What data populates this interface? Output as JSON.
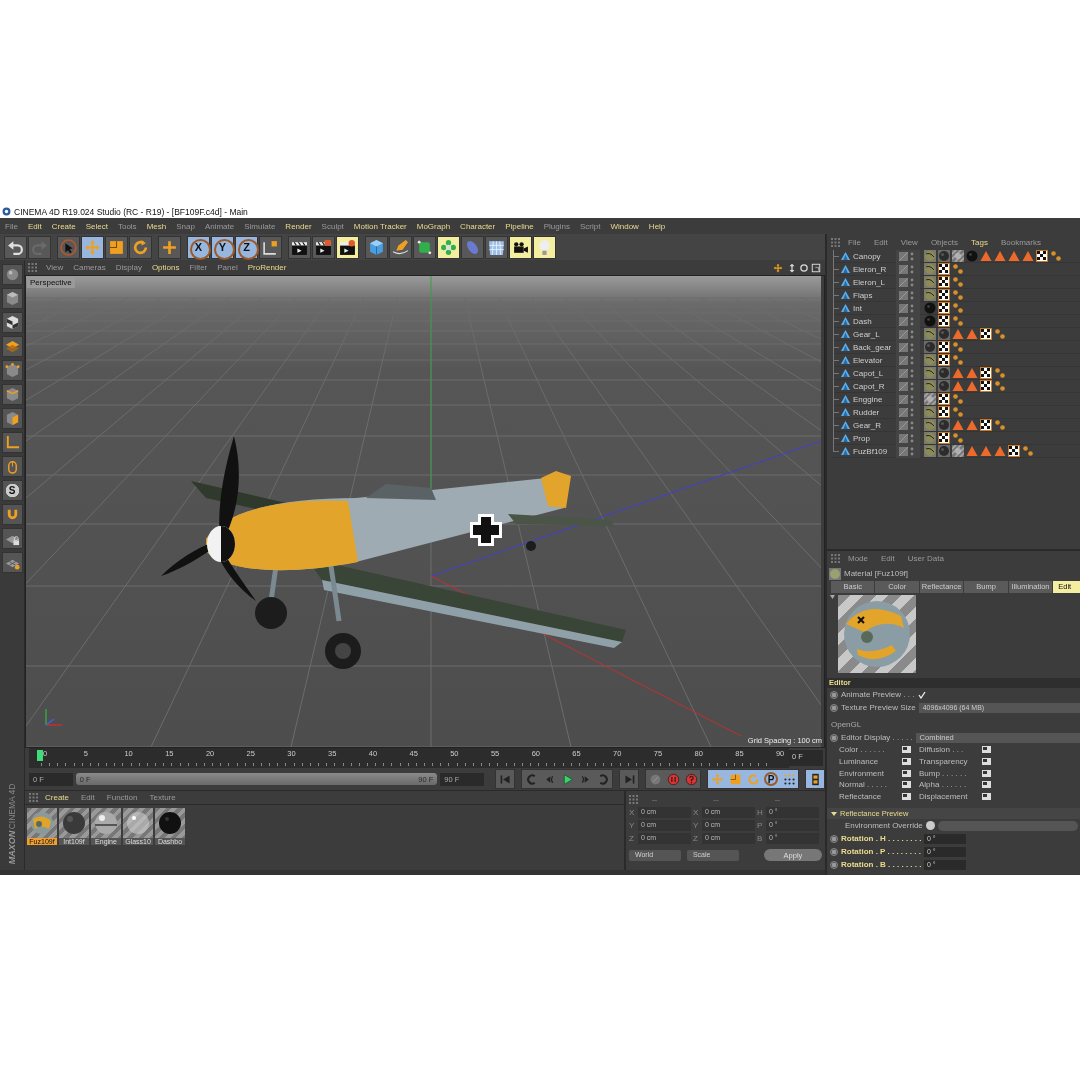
{
  "window": {
    "title": "CINEMA 4D R19.024 Studio (RC - R19) - [BF109F.c4d] - Main"
  },
  "menu": [
    {
      "label": "File",
      "highlighted": false
    },
    {
      "label": "Edit",
      "highlighted": true
    },
    {
      "label": "Create",
      "highlighted": true
    },
    {
      "label": "Select",
      "highlighted": true
    },
    {
      "label": "Tools",
      "highlighted": false
    },
    {
      "label": "Mesh",
      "highlighted": true
    },
    {
      "label": "Snap",
      "highlighted": false
    },
    {
      "label": "Animate",
      "highlighted": false
    },
    {
      "label": "Simulate",
      "highlighted": false
    },
    {
      "label": "Render",
      "highlighted": true
    },
    {
      "label": "Sculpt",
      "highlighted": false
    },
    {
      "label": "Motion Tracker",
      "highlighted": true
    },
    {
      "label": "MoGraph",
      "highlighted": true
    },
    {
      "label": "Character",
      "highlighted": true
    },
    {
      "label": "Pipeline",
      "highlighted": true
    },
    {
      "label": "Plugins",
      "highlighted": false
    },
    {
      "label": "Script",
      "highlighted": false
    },
    {
      "label": "Window",
      "highlighted": true
    },
    {
      "label": "Help",
      "highlighted": true
    }
  ],
  "toolbar": [
    {
      "tools": [
        {
          "kind": "undo",
          "selected": false
        },
        {
          "kind": "redo",
          "selected": false
        }
      ]
    },
    {
      "tools": [
        {
          "kind": "select",
          "selected": false
        },
        {
          "kind": "move",
          "selected": true
        },
        {
          "kind": "scale",
          "selected": false
        },
        {
          "kind": "rotate",
          "selected": false
        }
      ]
    },
    {
      "tools": [
        {
          "kind": "add",
          "selected": false
        }
      ]
    },
    {
      "tools": [
        {
          "kind": "axis",
          "label": "X",
          "selected": true
        },
        {
          "kind": "axis",
          "label": "Y",
          "selected": true
        },
        {
          "kind": "axis",
          "label": "Z",
          "selected": true
        },
        {
          "kind": "coordinates",
          "selected": false
        }
      ]
    },
    {
      "tools": [
        {
          "kind": "render-view",
          "selected": false
        },
        {
          "kind": "render-picture",
          "selected": false
        },
        {
          "kind": "render-settings",
          "selected": false
        }
      ]
    },
    {
      "tools": [
        {
          "kind": "cube",
          "selected": false
        },
        {
          "kind": "pen",
          "selected": false
        },
        {
          "kind": "subdivision",
          "selected": false
        },
        {
          "kind": "cloner",
          "selected": false
        },
        {
          "kind": "deformer",
          "selected": false
        },
        {
          "kind": "floor",
          "selected": false
        },
        {
          "kind": "camera",
          "selected": false
        },
        {
          "kind": "light",
          "selected": false
        }
      ]
    }
  ],
  "sidebar": {
    "tools": [
      {
        "kind": "sphere"
      },
      {
        "kind": "model"
      },
      {
        "kind": "texture"
      },
      {
        "kind": "workplane"
      },
      {
        "kind": "points"
      },
      {
        "kind": "edges"
      },
      {
        "kind": "polygons"
      },
      {
        "kind": "axis"
      },
      {
        "kind": "tweak"
      },
      {
        "kind": "snap",
        "label": "S"
      },
      {
        "kind": "magnet"
      },
      {
        "kind": "lock"
      },
      {
        "kind": "grid"
      }
    ],
    "logo": {
      "brand": "MAXON",
      "product": "CINEMA 4D"
    }
  },
  "viewport": {
    "menu": [
      {
        "label": "View",
        "highlighted": false
      },
      {
        "label": "Cameras",
        "highlighted": false
      },
      {
        "label": "Display",
        "highlighted": false
      },
      {
        "label": "Options",
        "highlighted": true
      },
      {
        "label": "Filter",
        "highlighted": false
      },
      {
        "label": "Panel",
        "highlighted": false
      },
      {
        "label": "ProRender",
        "highlighted": true
      }
    ],
    "camera": "Perspective",
    "grid_spacing": "Grid Spacing : 100 cm"
  },
  "timeline": {
    "ruler": [
      "0",
      "5",
      "10",
      "15",
      "20",
      "25",
      "30",
      "35",
      "40",
      "45",
      "50",
      "55",
      "60",
      "65",
      "70",
      "75",
      "80",
      "85",
      "90"
    ],
    "playhead": {
      "level": 0
    },
    "current_frame": "0 F",
    "start": "0 F",
    "range_start": "0 F",
    "range_bar": {
      "level": 1
    },
    "range_end": "90 F",
    "end": "90 F",
    "controls": [
      {
        "kind": "first"
      },
      {
        "kind": "prev-key"
      },
      {
        "kind": "prev-frame"
      },
      {
        "kind": "play"
      },
      {
        "kind": "next-frame"
      },
      {
        "kind": "next-key"
      },
      {
        "kind": "last"
      },
      {
        "kind": "key-off"
      },
      {
        "kind": "record"
      },
      {
        "kind": "autokey"
      },
      {
        "kind": "key-move"
      },
      {
        "kind": "key-scale"
      },
      {
        "kind": "key-rotate"
      },
      {
        "kind": "key-param",
        "label": "P"
      },
      {
        "kind": "key-points"
      },
      {
        "kind": "film"
      }
    ]
  },
  "materials": {
    "menu": [
      {
        "label": "Create",
        "highlighted": true
      },
      {
        "label": "Edit",
        "highlighted": false
      },
      {
        "label": "Function",
        "highlighted": false
      },
      {
        "label": "Texture",
        "highlighted": false
      }
    ],
    "items": [
      {
        "name": "Fuz109f",
        "kind": "camo",
        "selected": true
      },
      {
        "name": "Int109f",
        "kind": "dark",
        "selected": false
      },
      {
        "name": "Engine",
        "kind": "chrome",
        "selected": false
      },
      {
        "name": "Glass10",
        "kind": "glass",
        "selected": false
      },
      {
        "name": "Dashbo",
        "kind": "black",
        "selected": false
      }
    ]
  },
  "coordinates": {
    "headers": [
      "--",
      "--",
      "--"
    ],
    "rows": [
      [
        {
          "axis": "X",
          "value": "0 cm"
        },
        {
          "axis": "X",
          "value": "0 cm"
        },
        {
          "axis": "H",
          "value": "0 °"
        }
      ],
      [
        {
          "axis": "Y",
          "value": "0 cm"
        },
        {
          "axis": "Y",
          "value": "0 cm"
        },
        {
          "axis": "P",
          "value": "0 °"
        }
      ],
      [
        {
          "axis": "Z",
          "value": "0 cm"
        },
        {
          "axis": "Z",
          "value": "0 cm"
        },
        {
          "axis": "B",
          "value": "0 °"
        }
      ]
    ],
    "dropdowns": [
      "World",
      "Scale"
    ],
    "apply": "Apply"
  },
  "objects": {
    "menu": [
      {
        "label": "File",
        "highlighted": false
      },
      {
        "label": "Edit",
        "highlighted": false
      },
      {
        "label": "View",
        "highlighted": false
      },
      {
        "label": "Objects",
        "highlighted": false
      },
      {
        "label": "Tags",
        "highlighted": true
      },
      {
        "label": "Bookmarks",
        "highlighted": false
      }
    ],
    "items": [
      {
        "name": "Canopy",
        "tags": [
          {
            "kind": "texture"
          },
          {
            "kind": "sphere"
          },
          {
            "kind": "glass"
          },
          {
            "kind": "black"
          },
          {
            "kind": "selection"
          },
          {
            "kind": "selection"
          },
          {
            "kind": "selection"
          },
          {
            "kind": "selection"
          },
          {
            "kind": "uvw"
          },
          {
            "kind": "phong"
          }
        ]
      },
      {
        "name": "Eleron_R",
        "tags": [
          {
            "kind": "texture"
          },
          {
            "kind": "uvw"
          },
          {
            "kind": "phong"
          }
        ]
      },
      {
        "name": "Eleron_L",
        "tags": [
          {
            "kind": "texture"
          },
          {
            "kind": "uvw"
          },
          {
            "kind": "phong"
          }
        ]
      },
      {
        "name": "Flaps",
        "tags": [
          {
            "kind": "texture"
          },
          {
            "kind": "uvw"
          },
          {
            "kind": "phong"
          }
        ]
      },
      {
        "name": "Int",
        "tags": [
          {
            "kind": "black"
          },
          {
            "kind": "uvw"
          },
          {
            "kind": "phong"
          }
        ]
      },
      {
        "name": "Dash",
        "tags": [
          {
            "kind": "black"
          },
          {
            "kind": "uvw"
          },
          {
            "kind": "phong"
          }
        ]
      },
      {
        "name": "Gear_L",
        "tags": [
          {
            "kind": "texture"
          },
          {
            "kind": "sphere"
          },
          {
            "kind": "selection"
          },
          {
            "kind": "selection"
          },
          {
            "kind": "uvw"
          },
          {
            "kind": "phong"
          }
        ]
      },
      {
        "name": "Back_gear",
        "tags": [
          {
            "kind": "sphere"
          },
          {
            "kind": "uvw"
          },
          {
            "kind": "phong"
          }
        ]
      },
      {
        "name": "Elevator",
        "tags": [
          {
            "kind": "texture"
          },
          {
            "kind": "uvw"
          },
          {
            "kind": "phong"
          }
        ]
      },
      {
        "name": "Capot_L",
        "tags": [
          {
            "kind": "texture"
          },
          {
            "kind": "sphere"
          },
          {
            "kind": "selection"
          },
          {
            "kind": "selection"
          },
          {
            "kind": "uvw"
          },
          {
            "kind": "phong"
          }
        ]
      },
      {
        "name": "Capot_R",
        "tags": [
          {
            "kind": "texture"
          },
          {
            "kind": "sphere"
          },
          {
            "kind": "selection"
          },
          {
            "kind": "selection"
          },
          {
            "kind": "uvw"
          },
          {
            "kind": "phong"
          }
        ]
      },
      {
        "name": "Enggine",
        "tags": [
          {
            "kind": "glass"
          },
          {
            "kind": "uvw"
          },
          {
            "kind": "phong"
          }
        ]
      },
      {
        "name": "Rudder",
        "tags": [
          {
            "kind": "texture"
          },
          {
            "kind": "uvw"
          },
          {
            "kind": "phong"
          }
        ]
      },
      {
        "name": "Gear_R",
        "tags": [
          {
            "kind": "texture"
          },
          {
            "kind": "sphere"
          },
          {
            "kind": "selection"
          },
          {
            "kind": "selection"
          },
          {
            "kind": "uvw"
          },
          {
            "kind": "phong"
          }
        ]
      },
      {
        "name": "Prop",
        "tags": [
          {
            "kind": "texture"
          },
          {
            "kind": "uvw"
          },
          {
            "kind": "phong"
          }
        ]
      },
      {
        "name": "FuzBf109",
        "tags": [
          {
            "kind": "texture"
          },
          {
            "kind": "sphere"
          },
          {
            "kind": "glass"
          },
          {
            "kind": "selection"
          },
          {
            "kind": "selection"
          },
          {
            "kind": "selection"
          },
          {
            "kind": "uvw"
          },
          {
            "kind": "phong"
          }
        ]
      }
    ]
  },
  "attributes": {
    "menu": [
      {
        "label": "Mode",
        "highlighted": false
      },
      {
        "label": "Edit",
        "highlighted": false
      },
      {
        "label": "User Data",
        "highlighted": false
      }
    ],
    "material": "Material [Fuz109f]",
    "tabs": [
      {
        "label": "Basic",
        "selected": false
      },
      {
        "label": "Color",
        "selected": false
      },
      {
        "label": "Reflectance",
        "selected": false
      },
      {
        "label": "Bump",
        "selected": false
      },
      {
        "label": "Illumination",
        "selected": false
      },
      {
        "label": "Edit",
        "selected": true
      }
    ],
    "section": "Editor",
    "animate_preview": {
      "label": "Animate Preview . . .",
      "checked": true
    },
    "texture_preview": {
      "label": "Texture Preview Size",
      "value": "4096x4096 (64 MB)"
    },
    "group": "OpenGL",
    "editor_display": {
      "label": "Editor Display . . . . .",
      "value": "Combined"
    },
    "channels": [
      {
        "label": "Color . . . . . ."
      },
      {
        "label": "Diffusion . . ."
      },
      {
        "label": "Luminance"
      },
      {
        "label": "Transparency"
      },
      {
        "label": "Environment"
      },
      {
        "label": "Bump . . . . . ."
      },
      {
        "label": "Normal . . . . ."
      },
      {
        "label": "Alpha . . . . . ."
      },
      {
        "label": "Reflectance"
      },
      {
        "label": "Displacement"
      }
    ],
    "reflectance_preview": {
      "title": "Reflectance Preview",
      "expanded": true
    },
    "environment_override": "Environment Override",
    "rotations": [
      {
        "label": "Rotation . H . . . . . . . .",
        "value": "0 °"
      },
      {
        "label": "Rotation . P . . . . . . . .",
        "value": "0 °"
      },
      {
        "label": "Rotation . B . . . . . . . .",
        "value": "0 °"
      }
    ]
  }
}
